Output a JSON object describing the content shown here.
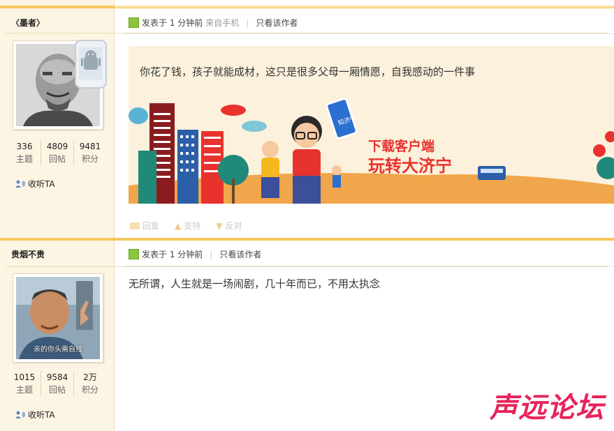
{
  "posts": [
    {
      "username": "〈墨者〉",
      "stats": [
        {
          "num": "336",
          "label": "主题"
        },
        {
          "num": "4809",
          "label": "回帖"
        },
        {
          "num": "9481",
          "label": "积分"
        }
      ],
      "follow_label": "收听TA",
      "meta": {
        "posted": "发表于 1 分钟前",
        "source": "来自手机",
        "only_author": "只看该作者"
      },
      "content": "你花了钱，孩子就能成材，这只是很多父母一厢情愿，自我感动的一件事",
      "banner": {
        "line1": "下载客户端",
        "line2": "玩转大济宁",
        "phone_text": "知济宁"
      },
      "actions": {
        "reply": "回复",
        "support": "支持",
        "oppose": "反对"
      }
    },
    {
      "username": "贵烟不贵",
      "stats": [
        {
          "num": "1015",
          "label": "主题"
        },
        {
          "num": "9584",
          "label": "回帖"
        },
        {
          "num": "2万",
          "label": "积分"
        }
      ],
      "follow_label": "收听TA",
      "avatar_caption": "亲的你头需自残",
      "meta": {
        "posted": "发表于 1 分钟前",
        "only_author": "只看该作者"
      },
      "content": "无所谓，人生就是一场闹剧，几十年而已，不用太执念"
    }
  ],
  "watermark": "声远论坛",
  "colors": {
    "accent": "#f7c65c",
    "sidebar": "#fdf5e3",
    "watermark": "#e8245a"
  }
}
